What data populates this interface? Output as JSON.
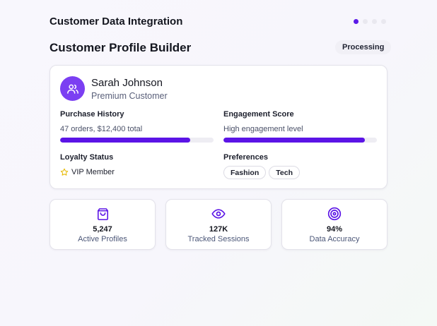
{
  "app": {
    "title": "Customer Data Integration"
  },
  "pager": {
    "count": 4,
    "active_index": 0
  },
  "page": {
    "title": "Customer Profile Builder",
    "status": "Processing"
  },
  "customer": {
    "avatar_icon": "users-icon",
    "name": "Sarah Johnson",
    "tier": "Premium Customer",
    "purchase_history": {
      "label": "Purchase History",
      "text": "47 orders, $12,400 total",
      "progress": 0.85
    },
    "engagement": {
      "label": "Engagement Score",
      "text": "High engagement level",
      "progress": 0.92
    },
    "loyalty": {
      "label": "Loyalty Status",
      "icon": "star-icon",
      "value": "VIP Member"
    },
    "preferences": {
      "label": "Preferences",
      "tags": [
        "Fashion",
        "Tech"
      ]
    }
  },
  "stats": [
    {
      "icon": "shopping-bag-icon",
      "value": "5,247",
      "label": "Active Profiles"
    },
    {
      "icon": "eye-icon",
      "value": "127K",
      "label": "Tracked Sessions"
    },
    {
      "icon": "target-icon",
      "value": "94%",
      "label": "Data Accuracy"
    }
  ],
  "colors": {
    "accent": "#5b14e6",
    "avatar_bg": "#7b3ff2",
    "star": "#e6b800"
  }
}
